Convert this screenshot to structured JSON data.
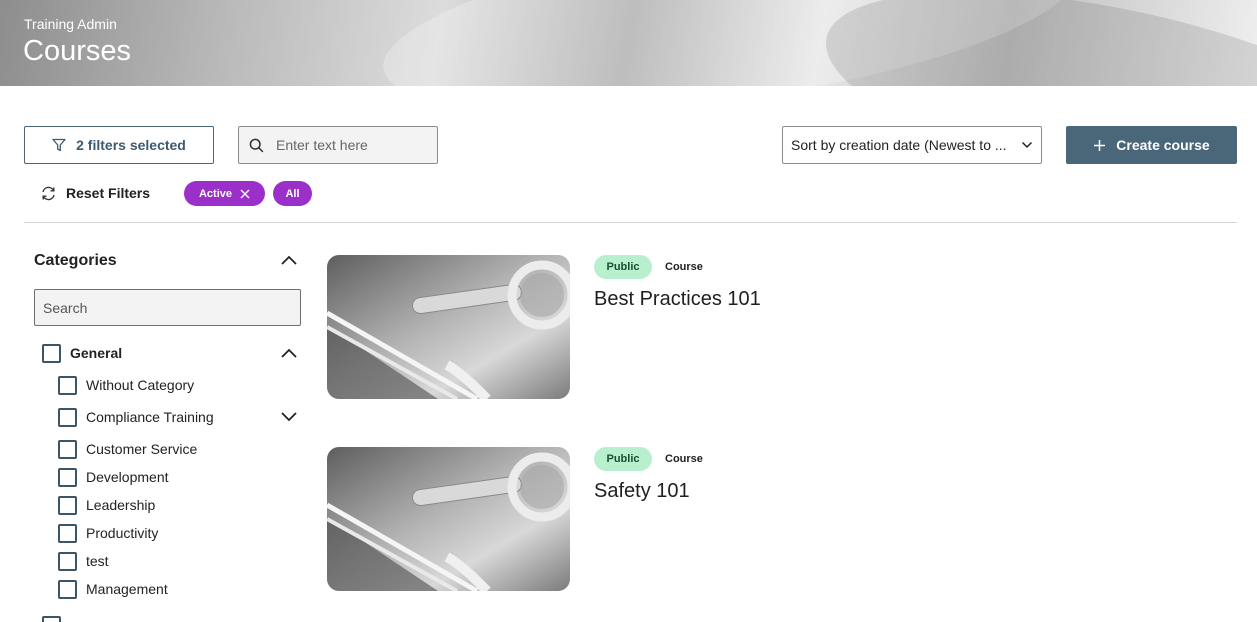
{
  "header": {
    "breadcrumb": "Training Admin",
    "title": "Courses"
  },
  "toolbar": {
    "filters_label": "2 filters selected",
    "search_placeholder": "Enter text here",
    "sort_value": "Sort by creation date (Newest to ...",
    "create_label": "Create course",
    "reset_label": "Reset Filters",
    "chips": [
      {
        "label": "Active",
        "removable": true
      },
      {
        "label": "All",
        "removable": false
      }
    ]
  },
  "sidebar": {
    "title": "Categories",
    "search_placeholder": "Search",
    "categories": [
      {
        "label": "General",
        "expanded": true,
        "checked": false
      },
      {
        "label": "Without Category",
        "checked": false
      },
      {
        "label": "Compliance Training",
        "checked": false,
        "expandable": true
      },
      {
        "label": "Customer Service",
        "checked": false
      },
      {
        "label": "Development",
        "checked": false
      },
      {
        "label": "Leadership",
        "checked": false
      },
      {
        "label": "Productivity",
        "checked": false
      },
      {
        "label": "test",
        "checked": false
      },
      {
        "label": "Management",
        "checked": false
      }
    ]
  },
  "courses": [
    {
      "visibility": "Public",
      "type": "Course",
      "title": "Best Practices 101"
    },
    {
      "visibility": "Public",
      "type": "Course",
      "title": "Safety 101"
    }
  ],
  "colors": {
    "primary": "#4a6679",
    "chip": "#9b2fc9",
    "public_badge": "#b8f0cf"
  },
  "icons": {
    "filter": "filter-icon",
    "search": "search-icon",
    "chevron": "chevron-down-icon",
    "plus": "plus-icon",
    "reset": "refresh-icon",
    "close": "close-icon"
  }
}
